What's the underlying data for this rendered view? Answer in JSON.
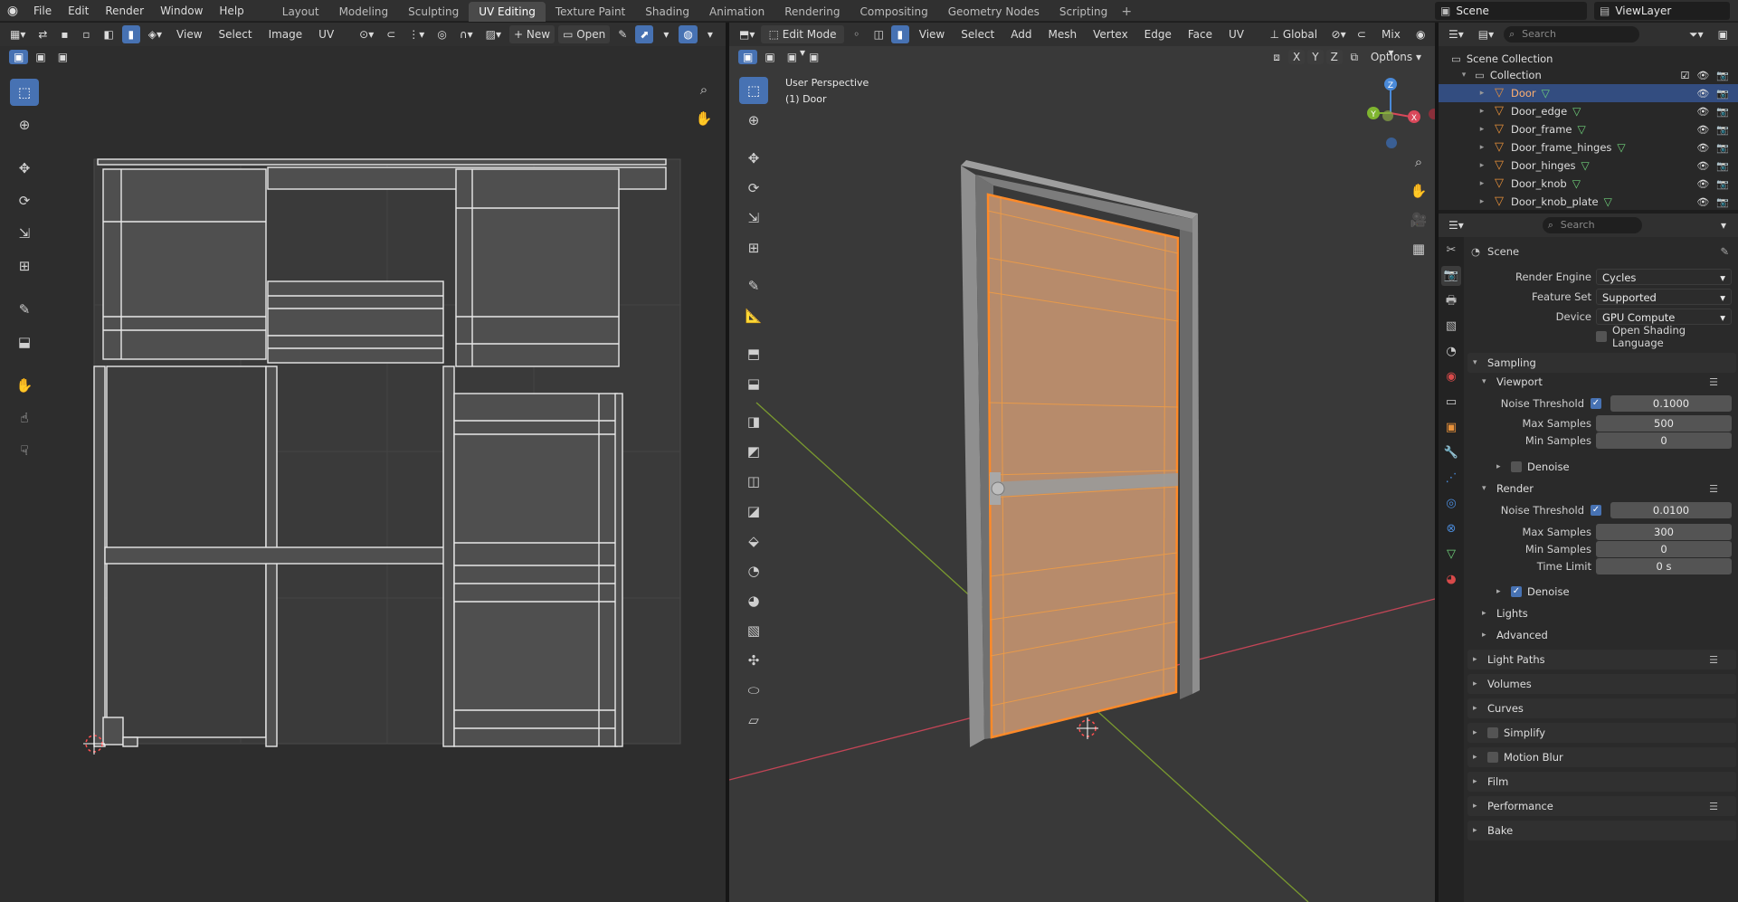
{
  "menubar": {
    "items": [
      "File",
      "Edit",
      "Render",
      "Window",
      "Help"
    ],
    "workspaces": [
      "Layout",
      "Modeling",
      "Sculpting",
      "UV Editing",
      "Texture Paint",
      "Shading",
      "Animation",
      "Rendering",
      "Compositing",
      "Geometry Nodes",
      "Scripting"
    ],
    "active_workspace": "UV Editing",
    "scene": "Scene",
    "view_layer": "ViewLayer"
  },
  "uv_editor": {
    "menus": [
      "View",
      "Select",
      "Image",
      "UV"
    ],
    "new_label": "New",
    "open_label": "Open"
  },
  "viewport": {
    "mode": "Edit Mode",
    "menus": [
      "View",
      "Select",
      "Add",
      "Mesh",
      "Vertex",
      "Edge",
      "Face",
      "UV"
    ],
    "orientation": "Global",
    "snap": "Mix",
    "options_label": "Options",
    "xyz": [
      "X",
      "Y",
      "Z"
    ],
    "overlay_line1": "User Perspective",
    "overlay_line2": "(1) Door"
  },
  "outliner": {
    "search_placeholder": "Search",
    "root": "Scene Collection",
    "collection": "Collection",
    "objects": [
      "Door",
      "Door_edge",
      "Door_frame",
      "Door_frame_hinges",
      "Door_hinges",
      "Door_knob",
      "Door_knob_plate"
    ],
    "selected": "Door"
  },
  "properties": {
    "search_placeholder": "Search",
    "context": "Scene",
    "render_engine_label": "Render Engine",
    "render_engine": "Cycles",
    "feature_set_label": "Feature Set",
    "feature_set": "Supported",
    "device_label": "Device",
    "device": "GPU Compute",
    "osl_label": "Open Shading Language",
    "sampling_label": "Sampling",
    "viewport_label": "Viewport",
    "noise_threshold_label": "Noise Threshold",
    "viewport_noise": "0.1000",
    "max_samples_label": "Max Samples",
    "viewport_max": "500",
    "min_samples_label": "Min Samples",
    "viewport_min": "0",
    "denoise_label": "Denoise",
    "render_label": "Render",
    "render_noise": "0.0100",
    "render_max": "300",
    "render_min": "0",
    "time_limit_label": "Time Limit",
    "time_limit": "0 s",
    "lights_label": "Lights",
    "advanced_label": "Advanced",
    "panels": [
      "Light Paths",
      "Volumes",
      "Curves",
      "Simplify",
      "Motion Blur",
      "Film",
      "Performance",
      "Bake"
    ]
  },
  "colors": {
    "accent": "#4772b3",
    "selection_orange": "#ff8a28",
    "mesh_icon": "#e8913a",
    "axis_x": "#d9485a",
    "axis_y": "#7fb52f",
    "axis_z": "#4a8ad9"
  },
  "icons": [
    "blender-logo",
    "search-icon",
    "eye-icon",
    "camera-icon",
    "mesh-icon",
    "vertex-group-icon",
    "zoom-icon",
    "hand-icon",
    "chevron-right-icon",
    "chevron-down-icon"
  ]
}
